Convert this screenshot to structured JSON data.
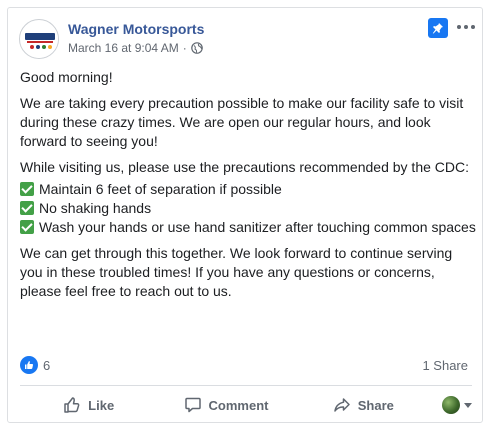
{
  "post": {
    "page_name": "Wagner Motorsports",
    "date": "March 16 at 9:04 AM",
    "separator": "·",
    "paragraphs": [
      "Good morning!",
      "We are taking every precaution possible to make our facility safe to visit during these crazy times. We are open our regular hours, and look forward to seeing you!",
      "While visiting us, please use the precautions recommended by the CDC:"
    ],
    "checklist": [
      "Maintain 6 feet of separation if possible",
      "No shaking hands",
      "Wash your hands or use hand sanitizer after touching common spaces"
    ],
    "closing": "We can get through this together. We look forward to continue serving you in these troubled times! If you have any questions or concerns, please feel free to reach out to us."
  },
  "stats": {
    "like_count": "6",
    "shares": "1 Share"
  },
  "actions": {
    "like": "Like",
    "comment": "Comment",
    "share": "Share"
  },
  "colors": {
    "link": "#385898",
    "brand_blue": "#1877f2",
    "checkmark": "#43a047",
    "muted": "#606770"
  },
  "icons": {
    "pin": "pin-icon",
    "more": "more-options-icon",
    "globe": "globe-icon",
    "like": "thumbs-up-icon",
    "comment": "comment-bubble-icon",
    "share": "share-arrow-icon"
  }
}
